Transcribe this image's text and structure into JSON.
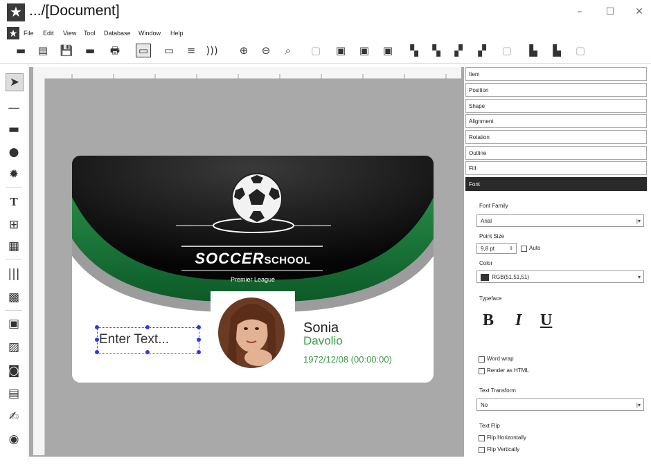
{
  "window": {
    "title": ".../[Document]",
    "minimize": "–",
    "maximize": "☐",
    "close": "✕"
  },
  "menu": [
    "File",
    "Edit",
    "View",
    "Tool",
    "Database",
    "Window",
    "Help"
  ],
  "card": {
    "title_bold": "SOCCER",
    "title_light": "SCHOOL",
    "subtitle": "Premier League",
    "first_name": "Sonia",
    "last_name": "Davolio",
    "date": "1972/12/08 (00:00:00)",
    "placeholder_text": "Enter Text...",
    "accent_color": "#3b9a4a"
  },
  "panel": {
    "sections": [
      "Item",
      "Position",
      "Shape",
      "Alignment",
      "Rotation",
      "Outline",
      "Fill",
      "Font"
    ],
    "active_section": "Font",
    "font_family_label": "Font Family",
    "font_family_value": "Arial",
    "point_size_label": "Point Size",
    "point_size_value": "9,8 pt",
    "auto_label": "Auto",
    "color_label": "Color",
    "color_value": "RGB(51,51,51)",
    "color_swatch": "#333333",
    "typeface_label": "Typeface",
    "bold": "B",
    "italic": "I",
    "underline": "U",
    "word_wrap": "Word wrap",
    "render_html": "Render as HTML",
    "text_transform_label": "Text Transform",
    "text_transform_value": "No",
    "text_flip_label": "Text Flip",
    "flip_h": "Flip Horizontally",
    "flip_v": "Flip Vertically"
  }
}
